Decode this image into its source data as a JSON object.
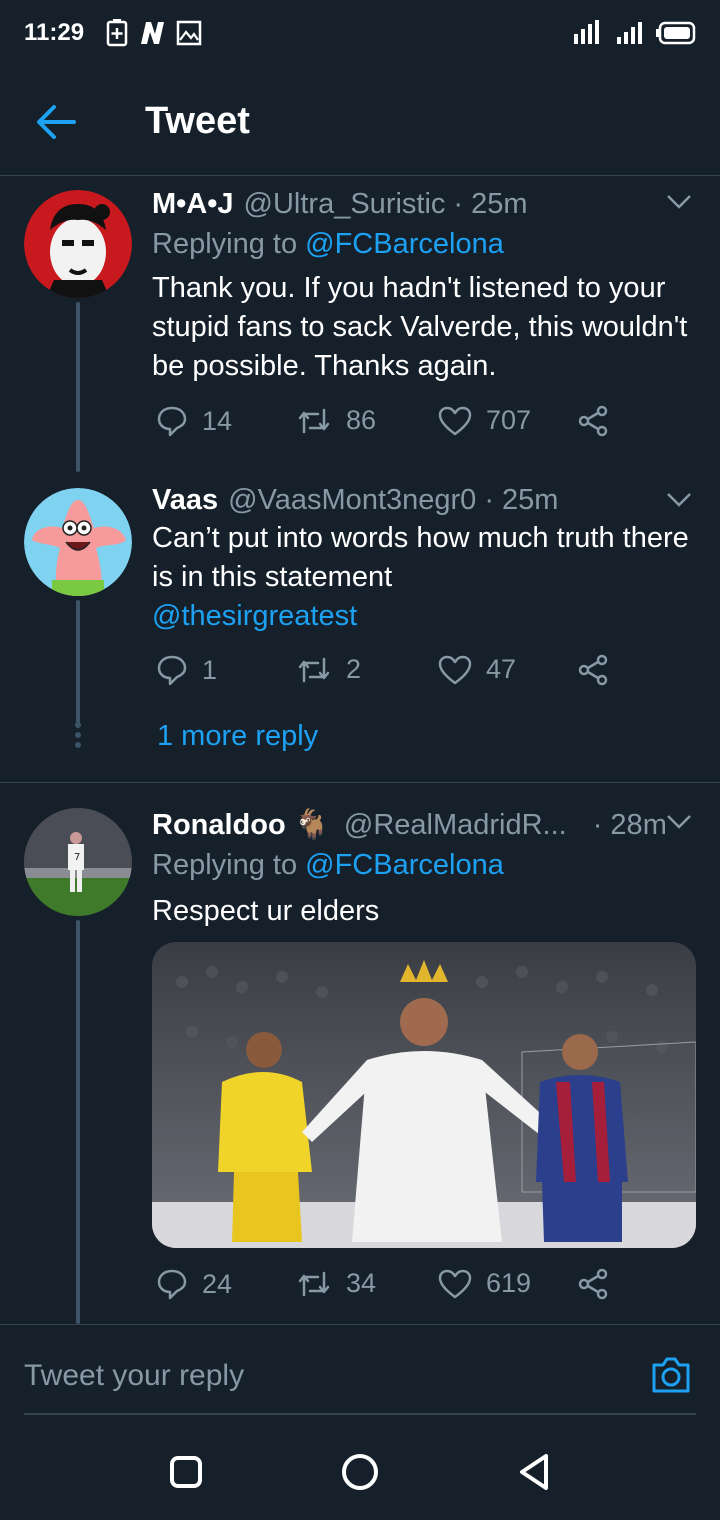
{
  "status_bar": {
    "time": "11:29"
  },
  "app_bar": {
    "title": "Tweet"
  },
  "tweets": [
    {
      "name": "M•A•J",
      "handle": "@Ultra_Suristic",
      "time": "· 25m",
      "replying_prefix": "Replying to",
      "replying_to": "@FCBarcelona",
      "text": "Thank you. If you hadn't listened to your stupid fans to sack Valverde, this wouldn't be possible. Thanks again.",
      "replies": "14",
      "retweets": "86",
      "likes": "707"
    },
    {
      "name": "Vaas",
      "handle": "@VaasMont3negr0",
      "time": "· 25m",
      "text": "Can’t put into words how much truth there is in this statement",
      "mention": "@thesirgreatest",
      "replies": "1",
      "retweets": "2",
      "likes": "47",
      "more_replies": "1 more reply"
    },
    {
      "name": "Ronaldoo 🐐",
      "handle": "@RealMadridR...",
      "time": "· 28m",
      "replying_prefix": "Replying to",
      "replying_to": "@FCBarcelona",
      "text": "Respect ur elders",
      "replies": "24",
      "retweets": "34",
      "likes": "619"
    }
  ],
  "reply_box": {
    "placeholder": "Tweet your reply"
  },
  "icons": {
    "back": "arrow-left-icon",
    "reply": "comment-icon",
    "retweet": "retweet-icon",
    "like": "heart-icon",
    "share": "share-icon",
    "camera": "camera-icon"
  },
  "colors": {
    "background": "#15202b",
    "accent": "#1da1f2",
    "muted": "#8899a6",
    "border": "#38444d"
  }
}
